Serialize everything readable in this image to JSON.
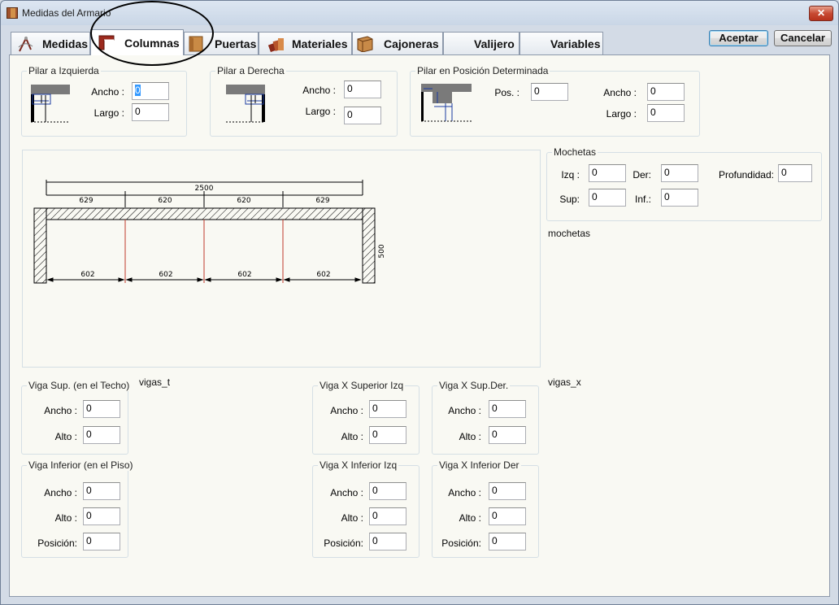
{
  "window": {
    "title": "Medidas del Armario",
    "close_label": "✕"
  },
  "tabs": [
    {
      "label": "Medidas",
      "icon": "compass-icon"
    },
    {
      "label": "Columnas",
      "icon": "column-icon"
    },
    {
      "label": "Puertas",
      "icon": "door-icon"
    },
    {
      "label": "Materiales",
      "icon": "materials-icon"
    },
    {
      "label": "Cajoneras",
      "icon": "drawer-icon"
    },
    {
      "label": "Valijero",
      "icon": ""
    },
    {
      "label": "Variables",
      "icon": ""
    }
  ],
  "buttons": {
    "accept": "Aceptar",
    "cancel": "Cancelar"
  },
  "pilar_izq": {
    "title": "Pilar a Izquierda",
    "ancho_label": "Ancho :",
    "ancho": "0",
    "largo_label": "Largo :",
    "largo": "0"
  },
  "pilar_der": {
    "title": "Pilar a Derecha",
    "ancho_label": "Ancho :",
    "ancho": "0",
    "largo_label": "Largo :",
    "largo": "0"
  },
  "pilar_pos": {
    "title": "Pilar en Posición Determinada",
    "pos_label": "Pos. :",
    "pos": "0",
    "ancho_label": "Ancho :",
    "ancho": "0",
    "largo_label": "Largo :",
    "largo": "0"
  },
  "mochetas": {
    "title": "Mochetas",
    "izq_label": "Izq :",
    "izq": "0",
    "der_label": "Der:",
    "der": "0",
    "prof_label": "Profundidad:",
    "prof": "0",
    "sup_label": "Sup:",
    "sup": "0",
    "inf_label": "Inf.:",
    "inf": "0",
    "note": "mochetas"
  },
  "drawing": {
    "total": "2500",
    "sections_top": [
      "629",
      "620",
      "620",
      "629"
    ],
    "sections_bottom": [
      "602",
      "602",
      "602",
      "602"
    ],
    "depth": "500"
  },
  "vigas_t": "vigas_t",
  "vigas_x": "vigas_x",
  "viga_sup": {
    "title": "Viga Sup. (en el Techo)",
    "ancho_label": "Ancho :",
    "ancho": "0",
    "alto_label": "Alto :",
    "alto": "0"
  },
  "viga_inf": {
    "title": "Viga Inferior (en el Piso)",
    "ancho_label": "Ancho :",
    "ancho": "0",
    "alto_label": "Alto :",
    "alto": "0",
    "pos_label": "Posición:",
    "pos": "0"
  },
  "viga_x_sup_izq": {
    "title": "Viga X Superior Izq",
    "ancho_label": "Ancho :",
    "ancho": "0",
    "alto_label": "Alto :",
    "alto": "0"
  },
  "viga_x_sup_der": {
    "title": "Viga X Sup.Der.",
    "ancho_label": "Ancho :",
    "ancho": "0",
    "alto_label": "Alto :",
    "alto": "0"
  },
  "viga_x_inf_izq": {
    "title": "Viga X Inferior Izq",
    "ancho_label": "Ancho :",
    "ancho": "0",
    "alto_label": "Alto :",
    "alto": "0",
    "pos_label": "Posición:",
    "pos": "0"
  },
  "viga_x_inf_der": {
    "title": "Viga X Inferior Der",
    "ancho_label": "Ancho :",
    "ancho": "0",
    "alto_label": "Alto :",
    "alto": "0",
    "pos_label": "Posición:",
    "pos": "0"
  }
}
